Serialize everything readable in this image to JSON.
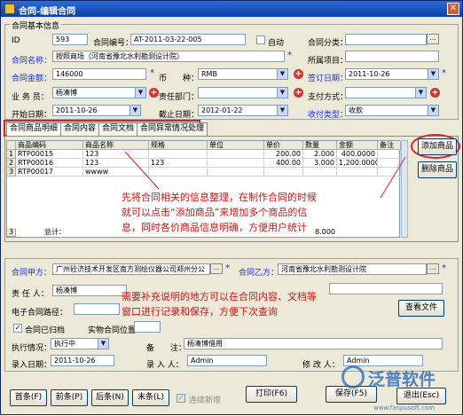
{
  "window": {
    "title": "合同-编辑合同",
    "close": "✕"
  },
  "basic": {
    "group_label": "合同基本信息",
    "id_label": "ID",
    "id_value": "593",
    "code_label": "合同编号：",
    "code_value": "AT-2011-03-22-005",
    "auto_label": "自动",
    "category_label": "合同分类：",
    "category_value": "",
    "name_label": "合同名称：",
    "name_value": "按照商场（河南省豫北水利勘测设计院）",
    "region_label": "所属项目：",
    "region_value": "",
    "amount_label": "合同金额：",
    "amount_value": "146000",
    "currency_label": "币　　种：",
    "currency_value": "RMB",
    "sign_date_label": "签订日期：",
    "sign_date_value": "2011-10-26",
    "salesman_label": "业 务 员：",
    "salesman_value": "杨凑博",
    "dept_label": "责任部门：",
    "dept_value": "",
    "pay_method_label": "支付方式：",
    "pay_method_value": "",
    "start_label": "开始日期：",
    "start_value": "2011-10-26",
    "end_label": "截止日期：",
    "end_value": "2012-01-22",
    "collect_label": "收付类型：",
    "collect_value": "收款"
  },
  "tabs": [
    "合同商品明细",
    "合同内容",
    "合同文档",
    "合同异常情况处理"
  ],
  "table": {
    "columns": [
      "商品编码",
      "商品名称",
      "规格",
      "单位",
      "单价",
      "数量",
      "金额",
      "备注"
    ],
    "rows": [
      {
        "n": "1",
        "code": "RTP00015",
        "name": "123",
        "spec": "",
        "unit": "",
        "price": "200.00",
        "qty": "2.000",
        "amount": "400.0000",
        "note": ""
      },
      {
        "n": "2",
        "code": "RTP00016",
        "name": "123",
        "spec": "123",
        "unit": "",
        "price": "400.00",
        "qty": "3.000",
        "amount": "1,200.0000",
        "note": ""
      },
      {
        "n": "3",
        "code": "RTP00017",
        "name": "wwww",
        "spec": "",
        "unit": "",
        "price": "",
        "qty": "",
        "amount": "",
        "note": ""
      }
    ],
    "total_n": "3",
    "total_label": "总计：",
    "total_qty": "8.000"
  },
  "buttons": {
    "add_goods": "添加商品",
    "del_goods": "删除商品",
    "view_doc": "查看文件",
    "first": "首条(F)",
    "prev": "前条(P)",
    "next": "后条(N)",
    "last": "末条(L)",
    "keep_add": "连续新增",
    "print": "打印(F6)",
    "save": "保存(F5)",
    "exit": "退出(Esc)"
  },
  "party": {
    "a_label": "合同甲方：",
    "a_value": "广州砼济技术开发区南方测绘仪器公司郑州分公",
    "b_label": "合同乙方：",
    "b_value": "河南省豫北水利勘测设计院",
    "resp_label": "责 任 人：",
    "resp_value": "杨凑博",
    "efile_label": "电子合同路径：",
    "efile_value": "",
    "archived_label": "合同已归档",
    "location_label": "实物合同位置：",
    "location_value": "",
    "status_label": "执行情况：",
    "status_value": "执行中",
    "remark_label": "备　　注：",
    "remark_value": "杨凑博借用",
    "entry_date_label": "录入日期：",
    "entry_date_value": "2011-10-26",
    "entry_user_label": "录 入 人：",
    "entry_user_value": "Admin",
    "modifier_label": "修 改 人：",
    "modifier_value": "Admin"
  },
  "notes": {
    "n1a": "先将合同相关的信息整理，在制作合同的时候",
    "n1b": "就可以点击“添加商品”来增加多个商品的信",
    "n1c": "息，同时各价商品信息明确，方便用户统计",
    "n2a": "需要补充说明的地方可以在合同内容、文档等",
    "n2b": "窗口进行记录和保存，方便下次查询"
  },
  "watermark": {
    "brand": "泛普软件",
    "url": "www.fanpusoft.com"
  },
  "colors": {
    "title": "#0c3ea8",
    "label_blue": "#1b2fd6",
    "note_red": "#e01010",
    "highlight": "#e02020"
  }
}
